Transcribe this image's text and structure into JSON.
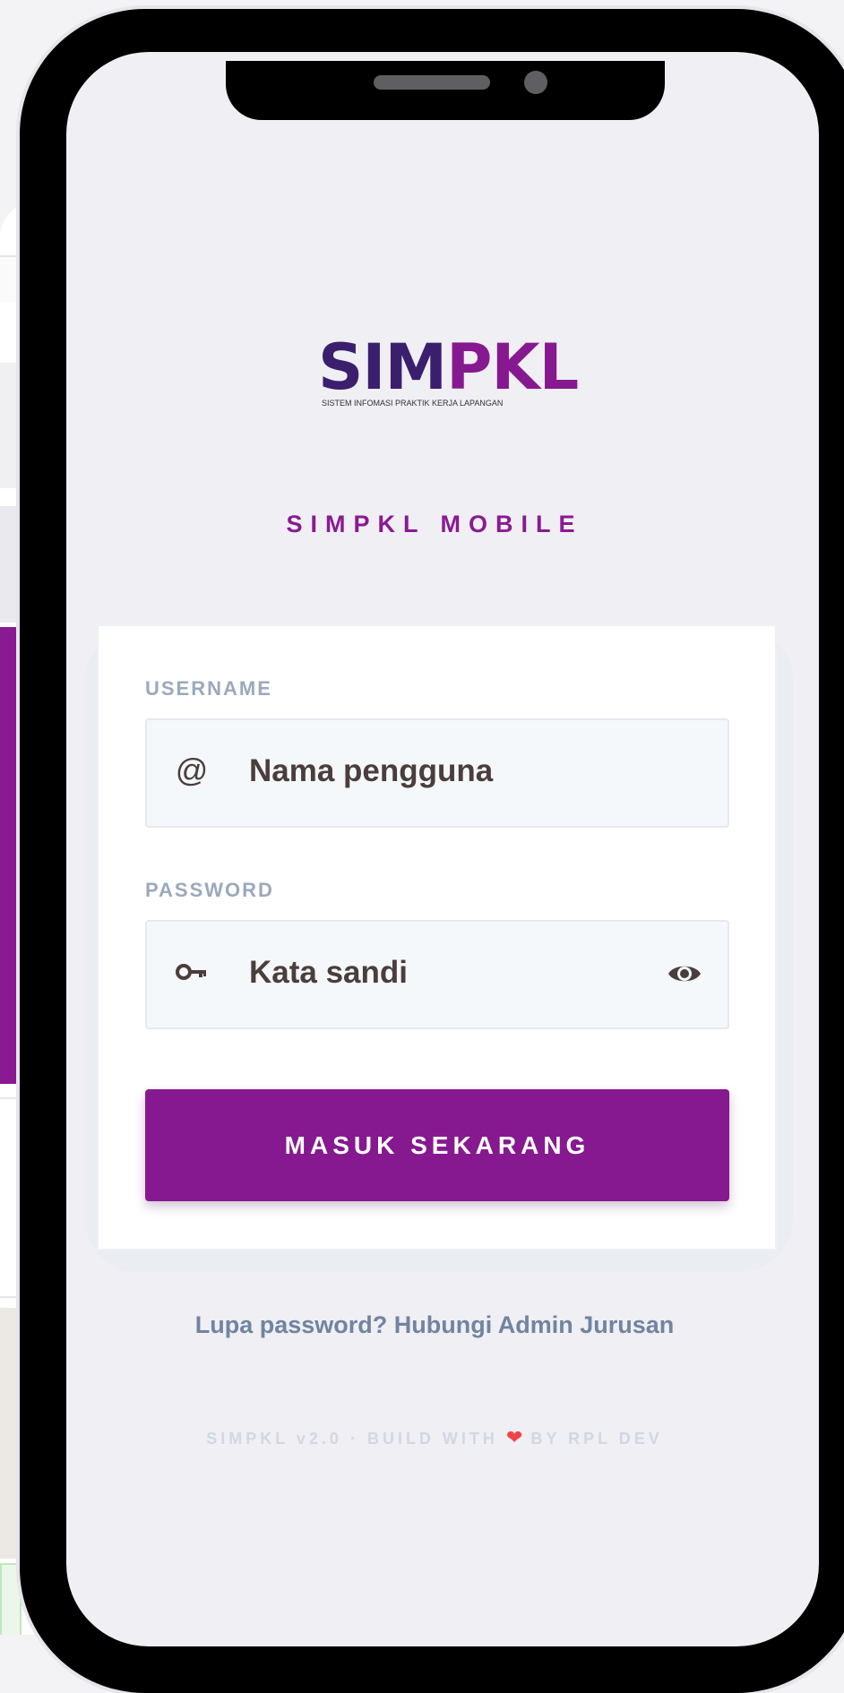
{
  "app": {
    "logo_main": "SIMPKL",
    "logo_subtitle": "SISTEM INFOMASI PRAKTIK KERJA LAPANGAN",
    "title": "SIMPKL MOBILE"
  },
  "form": {
    "username_label": "USERNAME",
    "username_placeholder": "Nama pengguna",
    "username_icon": "at-icon",
    "password_label": "PASSWORD",
    "password_placeholder": "Kata sandi",
    "password_icon": "key-icon",
    "toggle_icon": "eye-icon",
    "submit_label": "MASUK SEKARANG"
  },
  "help": {
    "forgot_text": "Lupa password? Hubungi Admin Jurusan"
  },
  "footer": {
    "prefix": "SIMPKL v2.0 · BUILD WITH",
    "heart": "❤",
    "suffix": "BY RPL DEV"
  },
  "colors": {
    "accent": "#86198f",
    "logo_dark": "#3b1f6e",
    "label_gray": "#9aa9bd",
    "link_gray": "#7184a0"
  }
}
